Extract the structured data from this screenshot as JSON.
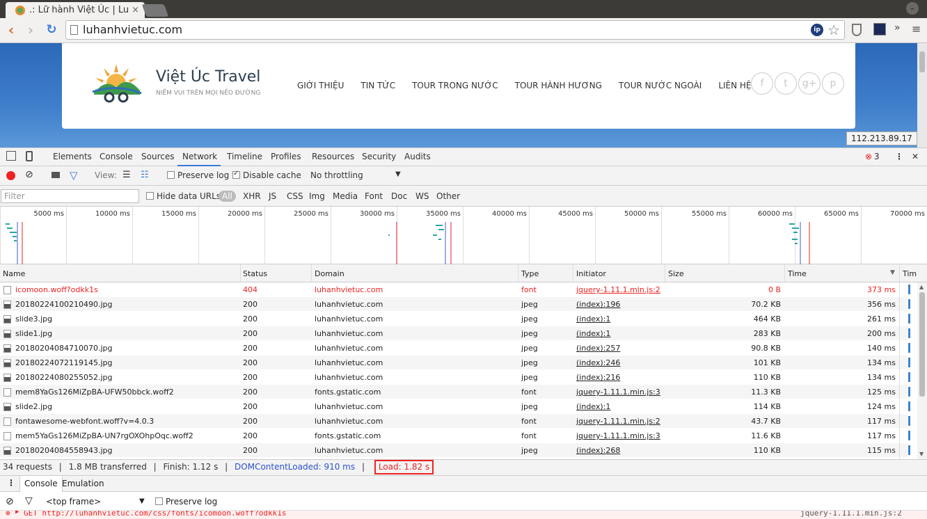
{
  "browser": {
    "tab_title": ".: Lữ hành Việt Úc | Lu",
    "tab_close": "×",
    "url": "luhanhvietuc.com",
    "ip_badge_icon": "ip"
  },
  "website": {
    "site_name": "Việt Úc Travel",
    "tagline": "NIỀM VUI TRÊN MỌI NẺO ĐƯỜNG",
    "menu": [
      "GIỚI THIỆU",
      "TIN TỨC",
      "TOUR TRONG NƯỚC",
      "TOUR HÀNH HƯƠNG",
      "TOUR NƯỚC NGOÀI",
      "LIÊN HỆ"
    ],
    "social": [
      "f",
      "t",
      "g+",
      "p"
    ],
    "ip_address": "112.213.89.17"
  },
  "devtools": {
    "tabs": [
      "Elements",
      "Console",
      "Sources",
      "Network",
      "Timeline",
      "Profiles",
      "Resources",
      "Security",
      "Audits"
    ],
    "active_tab": "Network",
    "error_count": "3",
    "close": "✕",
    "controls": {
      "view_label": "View:",
      "preserve_log": "Preserve log",
      "disable_cache": "Disable cache",
      "throttling": "No throttling"
    },
    "filter": {
      "placeholder": "Filter",
      "hide_data_urls": "Hide data URLs",
      "all": "All",
      "types": [
        "XHR",
        "JS",
        "CSS",
        "Img",
        "Media",
        "Font",
        "Doc",
        "WS",
        "Other"
      ]
    },
    "overview_ticks": [
      "5000 ms",
      "10000 ms",
      "15000 ms",
      "20000 ms",
      "25000 ms",
      "30000 ms",
      "35000 ms",
      "40000 ms",
      "45000 ms",
      "50000 ms",
      "55000 ms",
      "60000 ms",
      "65000 ms",
      "70000 ms"
    ],
    "columns": [
      "Name",
      "Status",
      "Domain",
      "Type",
      "Initiator",
      "Size",
      "Time",
      "Tim"
    ],
    "requests": [
      {
        "name": "icomoon.woff?odkk1s",
        "status": "404",
        "domain": "luhanhvietuc.com",
        "type": "font",
        "initiator": "jquery-1.11.1.min.js:2",
        "size": "0 B",
        "time": "373 ms",
        "error": true,
        "icon": "file"
      },
      {
        "name": "20180224100210490.jpg",
        "status": "200",
        "domain": "luhanhvietuc.com",
        "type": "jpeg",
        "initiator": "(index):196",
        "size": "70.2 KB",
        "time": "356 ms",
        "icon": "image"
      },
      {
        "name": "slide3.jpg",
        "status": "200",
        "domain": "luhanhvietuc.com",
        "type": "jpeg",
        "initiator": "(index):1",
        "size": "464 KB",
        "time": "261 ms",
        "icon": "image"
      },
      {
        "name": "slide1.jpg",
        "status": "200",
        "domain": "luhanhvietuc.com",
        "type": "jpeg",
        "initiator": "(index):1",
        "size": "283 KB",
        "time": "200 ms",
        "icon": "image"
      },
      {
        "name": "20180204084710070.jpg",
        "status": "200",
        "domain": "luhanhvietuc.com",
        "type": "jpeg",
        "initiator": "(index):257",
        "size": "90.8 KB",
        "time": "140 ms",
        "icon": "image"
      },
      {
        "name": "20180224072119145.jpg",
        "status": "200",
        "domain": "luhanhvietuc.com",
        "type": "jpeg",
        "initiator": "(index):246",
        "size": "101 KB",
        "time": "134 ms",
        "icon": "image"
      },
      {
        "name": "20180224080255052.jpg",
        "status": "200",
        "domain": "luhanhvietuc.com",
        "type": "jpeg",
        "initiator": "(index):216",
        "size": "110 KB",
        "time": "134 ms",
        "icon": "image"
      },
      {
        "name": "mem8YaGs126MiZpBA-UFW50bbck.woff2",
        "status": "200",
        "domain": "fonts.gstatic.com",
        "type": "font",
        "initiator": "jquery-1.11.1.min.js:3",
        "size": "11.3 KB",
        "time": "125 ms",
        "icon": "file"
      },
      {
        "name": "slide2.jpg",
        "status": "200",
        "domain": "luhanhvietuc.com",
        "type": "jpeg",
        "initiator": "(index):1",
        "size": "114 KB",
        "time": "124 ms",
        "icon": "image"
      },
      {
        "name": "fontawesome-webfont.woff?v=4.0.3",
        "status": "200",
        "domain": "luhanhvietuc.com",
        "type": "font",
        "initiator": "jquery-1.11.1.min.js:2",
        "size": "43.7 KB",
        "time": "117 ms",
        "icon": "file"
      },
      {
        "name": "mem5YaGs126MiZpBA-UN7rgOXOhpOqc.woff2",
        "status": "200",
        "domain": "fonts.gstatic.com",
        "type": "font",
        "initiator": "jquery-1.11.1.min.js:3",
        "size": "11.6 KB",
        "time": "117 ms",
        "icon": "file"
      },
      {
        "name": "20180204084558943.jpg",
        "status": "200",
        "domain": "luhanhvietuc.com",
        "type": "jpeg",
        "initiator": "(index):268",
        "size": "110 KB",
        "time": "115 ms",
        "icon": "image"
      }
    ],
    "summary": {
      "requests": "34 requests",
      "transferred": "1.8 MB transferred",
      "finish": "Finish: 1.12 s",
      "dom_content_loaded": "DOMContentLoaded: 910 ms",
      "load": "Load: 1.82 s"
    },
    "drawer": {
      "tabs": [
        "Console",
        "Emulation"
      ],
      "context": "<top frame>",
      "preserve_log": "Preserve log",
      "error_line": "GET http://luhanhvietuc.com/css/fonts/icomoon.woff?odkk1s",
      "error_source": "jquery-1.11.1.min.js:2"
    }
  }
}
